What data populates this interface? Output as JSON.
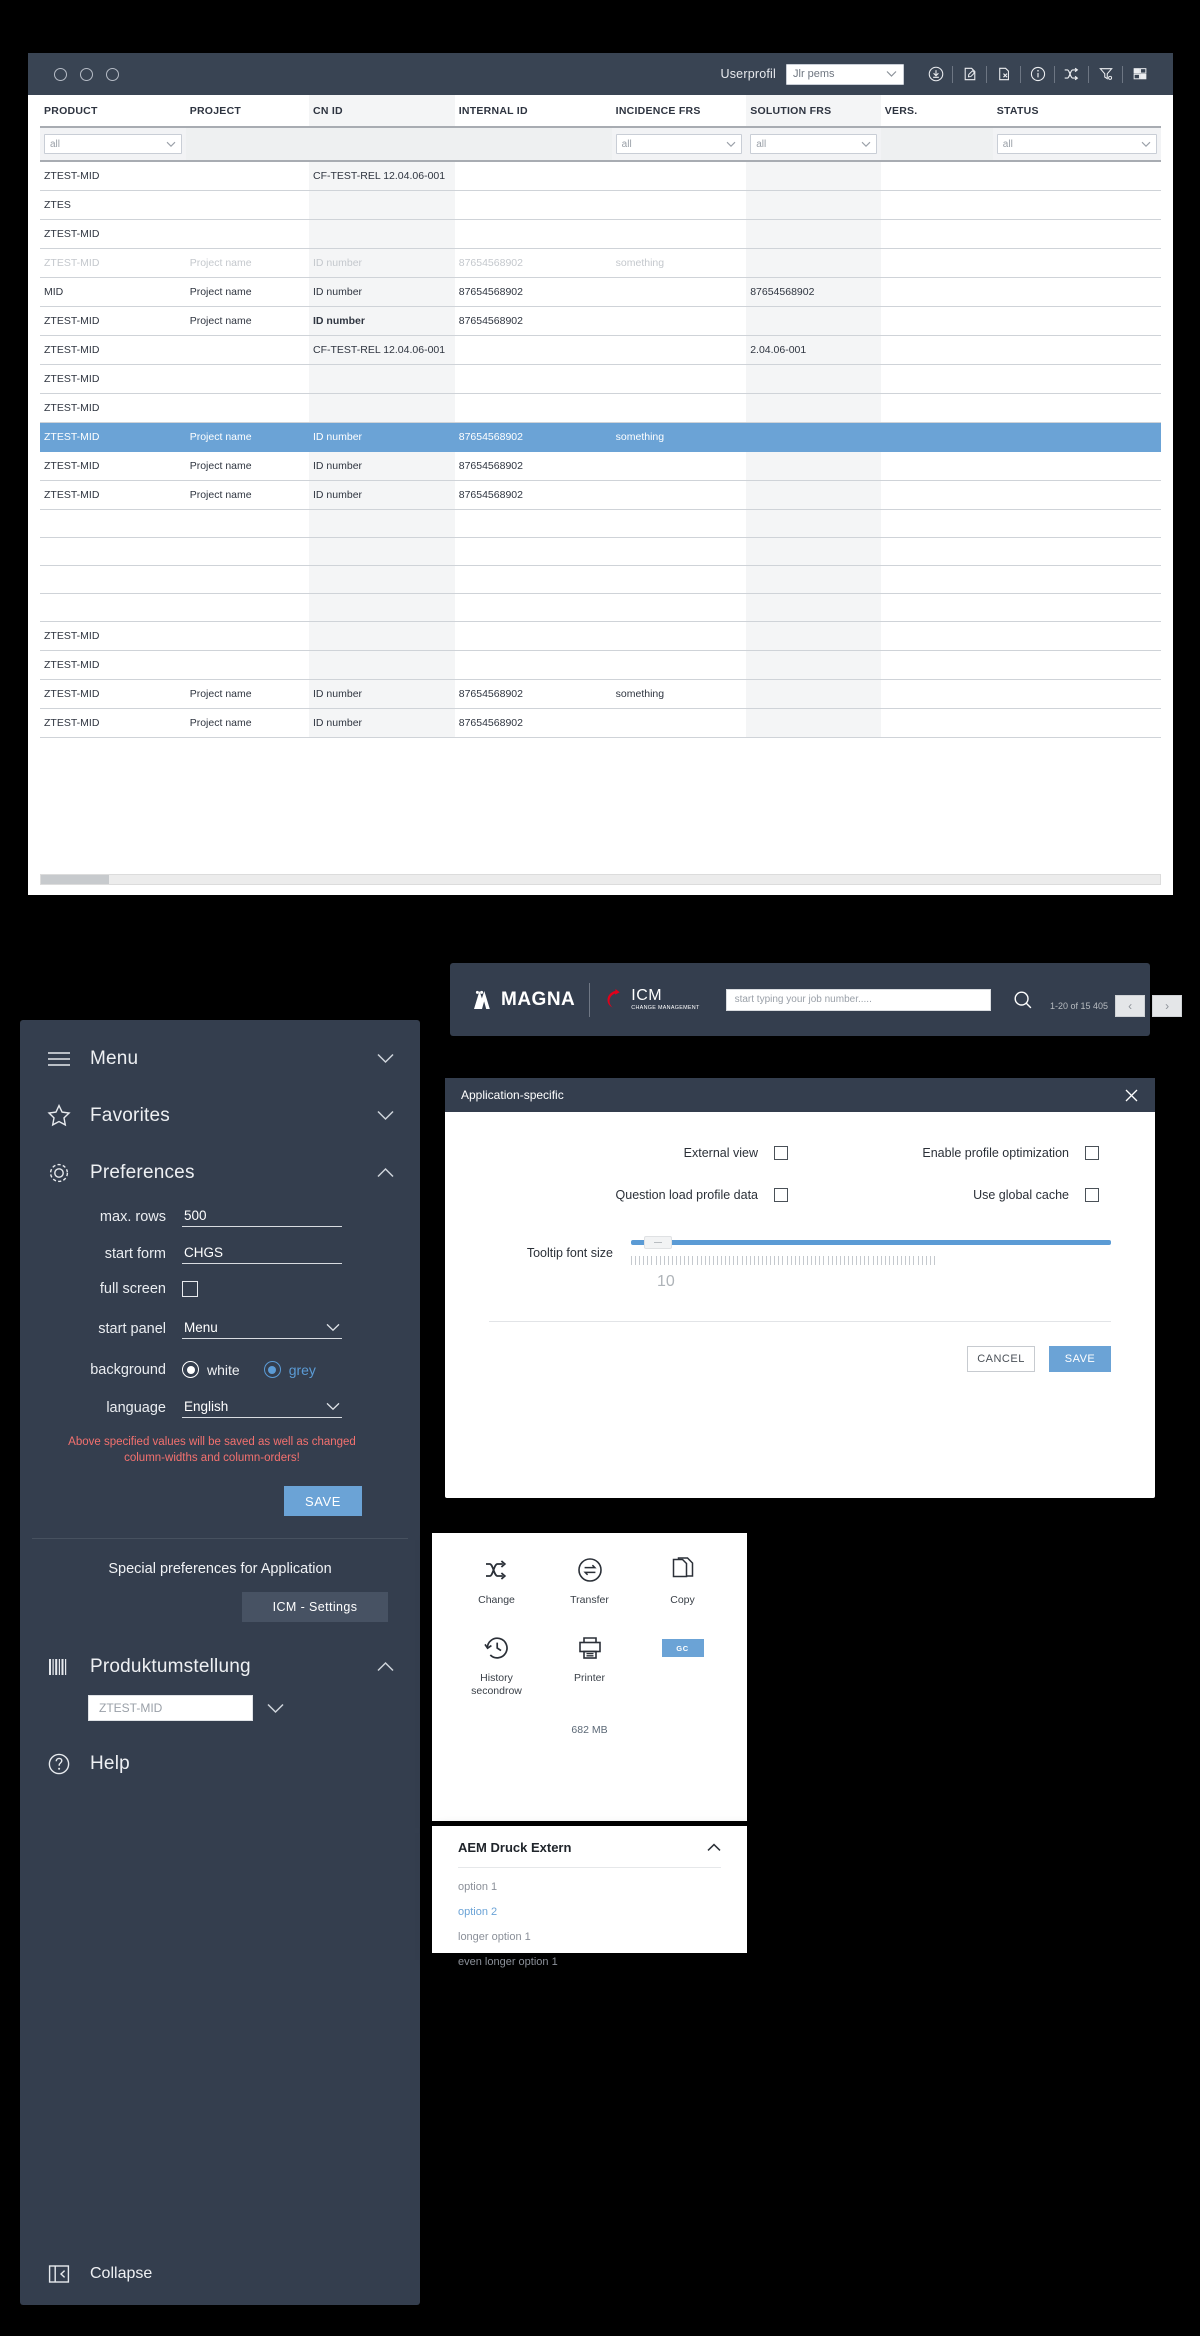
{
  "grid_window": {
    "titlebar": {
      "userprofil_label": "Userprofil",
      "profile_value": "Jlr pems",
      "icons": [
        "download-circle-icon",
        "edit-document-icon",
        "delete-document-icon",
        "info-circle-icon",
        "shuffle-icon",
        "filter-clear-icon",
        "layout-grid-icon"
      ]
    },
    "columns": [
      "PRODUCT",
      "PROJECT",
      "CN ID",
      "INTERNAL ID",
      "INCIDENCE FRS",
      "SOLUTION FRS",
      "VERS.",
      "STATUS"
    ],
    "filters": [
      "all",
      "",
      "",
      "",
      "all",
      "all",
      "",
      "all"
    ],
    "rows": [
      {
        "ghost": false,
        "selected": false,
        "cells": [
          "ZTEST-MID",
          "",
          "CF-TEST-REL 12.04.06-001",
          "",
          "",
          "",
          "",
          ""
        ]
      },
      {
        "ghost": false,
        "selected": false,
        "cells": [
          "ZTES",
          "",
          "",
          "",
          "",
          "",
          "",
          ""
        ]
      },
      {
        "ghost": false,
        "selected": false,
        "cells": [
          "ZTEST-MID",
          "",
          "",
          "",
          "",
          "",
          "",
          ""
        ]
      },
      {
        "ghost": true,
        "selected": false,
        "cells": [
          "ZTEST-MID",
          "Project name",
          "ID number",
          "87654568902",
          "something",
          "",
          "",
          ""
        ]
      },
      {
        "ghost": false,
        "selected": false,
        "cells": [
          "MID",
          "Project name",
          "ID number",
          "87654568902",
          "",
          "87654568902",
          "",
          ""
        ]
      },
      {
        "ghost": false,
        "selected": false,
        "bold_cn": true,
        "cells": [
          "ZTEST-MID",
          "Project name",
          "ID number",
          "87654568902",
          "",
          "",
          "",
          ""
        ]
      },
      {
        "ghost": false,
        "selected": false,
        "cells": [
          "ZTEST-MID",
          "",
          "CF-TEST-REL 12.04.06-001",
          "",
          "",
          "2.04.06-001",
          "",
          ""
        ]
      },
      {
        "ghost": false,
        "selected": false,
        "cells": [
          "ZTEST-MID",
          "",
          "",
          "",
          "",
          "",
          "",
          ""
        ]
      },
      {
        "ghost": false,
        "selected": false,
        "cells": [
          "ZTEST-MID",
          "",
          "",
          "",
          "",
          "",
          "",
          ""
        ]
      },
      {
        "ghost": false,
        "selected": true,
        "cells": [
          "ZTEST-MID",
          "Project name",
          "ID number",
          "87654568902",
          "something",
          "",
          "",
          ""
        ]
      },
      {
        "ghost": false,
        "selected": false,
        "cells": [
          "ZTEST-MID",
          "Project name",
          "ID number",
          "87654568902",
          "",
          "",
          "",
          ""
        ]
      },
      {
        "ghost": false,
        "selected": false,
        "cells": [
          "ZTEST-MID",
          "Project name",
          "ID number",
          "87654568902",
          "",
          "",
          "",
          ""
        ]
      },
      {
        "ghost": false,
        "selected": false,
        "cells": [
          "",
          "",
          "",
          "",
          "",
          "",
          "",
          ""
        ]
      },
      {
        "ghost": false,
        "selected": false,
        "cells": [
          "",
          "",
          "",
          "",
          "",
          "",
          "",
          ""
        ]
      },
      {
        "ghost": false,
        "selected": false,
        "cells": [
          "",
          "",
          "",
          "",
          "",
          "",
          "",
          ""
        ]
      },
      {
        "ghost": false,
        "selected": false,
        "cells": [
          "",
          "",
          "",
          "",
          "",
          "",
          "",
          ""
        ]
      },
      {
        "ghost": false,
        "selected": false,
        "cells": [
          "ZTEST-MID",
          "",
          "",
          "",
          "",
          "",
          "",
          ""
        ]
      },
      {
        "ghost": false,
        "selected": false,
        "cells": [
          "ZTEST-MID",
          "",
          "",
          "",
          "",
          "",
          "",
          ""
        ]
      },
      {
        "ghost": false,
        "selected": false,
        "cells": [
          "ZTEST-MID",
          "Project name",
          "ID number",
          "87654568902",
          "something",
          "",
          "",
          ""
        ]
      },
      {
        "ghost": false,
        "selected": false,
        "cells": [
          "ZTEST-MID",
          "Project name",
          "ID number",
          "87654568902",
          "",
          "",
          "",
          ""
        ]
      }
    ],
    "pager": {
      "range_label": "1-20 of 15 405",
      "prev": "‹",
      "next": "›"
    }
  },
  "sidebar": {
    "menu_label": "Menu",
    "favorites_label": "Favorites",
    "preferences_label": "Preferences",
    "prefs": {
      "max_rows_label": "max. rows",
      "max_rows_value": "500",
      "start_form_label": "start form",
      "start_form_value": "CHGS",
      "full_screen_label": "full screen",
      "start_panel_label": "start panel",
      "start_panel_value": "Menu",
      "background_label": "background",
      "background_white": "white",
      "background_grey": "grey",
      "language_label": "language",
      "language_value": "English",
      "warning": "Above specified values will be saved as well as changed column-widths and column-orders!",
      "save_label": "SAVE"
    },
    "special_title": "Special preferences for  Application",
    "icm_settings_label": "ICM  -  Settings",
    "produkt_label": "Produktumstellung",
    "produkt_value": "ZTEST-MID",
    "help_label": "Help",
    "collapse_label": "Collapse"
  },
  "magna_bar": {
    "brand": "MAGNA",
    "product": "ICM",
    "product_sub": "CHANGE MANAGEMENT",
    "search_placeholder": "start typing your job number....."
  },
  "modal": {
    "title": "Application-specific",
    "checkboxes": [
      {
        "label": "External view",
        "checked": false
      },
      {
        "label": "Enable profile optimization",
        "checked": false
      },
      {
        "label": "Question load profile data",
        "checked": false
      },
      {
        "label": "Use global cache",
        "checked": false
      }
    ],
    "slider_label": "Tooltip font size",
    "slider_value": "10",
    "cancel_label": "CANCEL",
    "save_label": "SAVE"
  },
  "actions_card": {
    "items": [
      {
        "label": "Change",
        "icon": "shuffle-icon"
      },
      {
        "label": "Transfer",
        "icon": "transfer-circle-icon"
      },
      {
        "label": "Copy",
        "icon": "copy-icon"
      },
      {
        "label": "History\nsecondrow",
        "icon": "history-clock-icon"
      },
      {
        "label": "Printer",
        "icon": "printer-icon"
      }
    ],
    "history_label_line1": "History",
    "history_label_line2": "secondrow",
    "gc_label": "GC",
    "memory": "682 MB"
  },
  "accordion_card": {
    "title": "AEM Druck Extern",
    "options": [
      {
        "label": "option 1",
        "selected": false
      },
      {
        "label": "option 2",
        "selected": true
      },
      {
        "label": "longer option 1",
        "selected": false
      },
      {
        "label": "even longer option 1",
        "selected": false
      }
    ]
  },
  "colors": {
    "panel_dark": "#343e4e",
    "titlebar_dark": "#394453",
    "accent_blue": "#6ba3d6",
    "warning_red": "#f3716f",
    "selected_row": "#6ba3d6"
  }
}
